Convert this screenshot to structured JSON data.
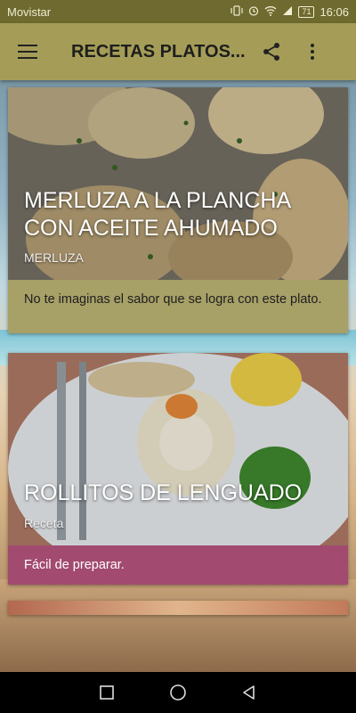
{
  "status_bar": {
    "carrier": "Movistar",
    "battery": "71",
    "time": "16:06"
  },
  "toolbar": {
    "title": "RECETAS PLATOS...",
    "icons": [
      "hamburger-menu-icon",
      "share-icon",
      "more-vert-icon"
    ]
  },
  "cards": [
    {
      "title": "MERLUZA A LA PLANCHA CON ACEITE AHUMADO",
      "subtitle": "MERLUZA",
      "description": "No te imaginas el sabor que se logra con este plato.",
      "desc_color": "#a7a067"
    },
    {
      "title": "ROLLITOS DE LENGUADO",
      "subtitle": "Receta",
      "description": "Fácil de preparar.",
      "desc_color": "#a24a70"
    }
  ],
  "nav_bar": {
    "icons": [
      "recents-square-icon",
      "home-circle-icon",
      "back-triangle-icon"
    ]
  },
  "colors": {
    "status_bar": "#6f6a2f",
    "toolbar": "#a59d57"
  }
}
